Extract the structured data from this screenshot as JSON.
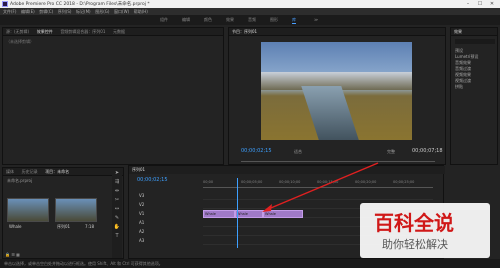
{
  "titlebar": {
    "title": "Adobe Premiere Pro CC 2018 - D:\\Program Files\\未命名.prproj *",
    "min": "–",
    "max": "☐",
    "close": "✕"
  },
  "menu": [
    "文件(F)",
    "编辑(E)",
    "剪辑(C)",
    "序列(S)",
    "标记(M)",
    "图形(G)",
    "窗口(W)",
    "帮助(H)"
  ],
  "workspaces": [
    "组件",
    "编辑",
    "颜色",
    "效果",
    "音频",
    "图形",
    "库",
    "≫"
  ],
  "source_panel": {
    "tabs": [
      "源：(无剪辑)",
      "效果控件",
      "音频剪辑混合器：序列01",
      "元数据"
    ],
    "note": "（未选择剪辑）"
  },
  "program_panel": {
    "tab": "节目：序列01",
    "timecode": "00;00;02;15",
    "fit": "适合",
    "quality": "完整",
    "duration": "00;00;07;18"
  },
  "effects_panel": {
    "tab": "效果",
    "items": [
      "预设",
      "Lumetri预设",
      "音频效果",
      "音频过渡",
      "视频效果",
      "视频过渡",
      "拼贴"
    ]
  },
  "project_panel": {
    "tabs": [
      "媒体",
      "历史记录",
      "项目：未命名"
    ],
    "file": "未命名.prproj",
    "clips": [
      {
        "name": "Whale",
        "duration": ""
      },
      {
        "name": "序列01",
        "duration": "7:18"
      }
    ]
  },
  "timeline": {
    "tab": "序列01",
    "timecode": "00;00;02;15",
    "ruler": [
      "00;00",
      "00;00;05;00",
      "00;00;10;00",
      "00;00;15;00",
      "00;00;20;00",
      "00;00;25;00"
    ],
    "tracks": [
      "V3",
      "V2",
      "V1",
      "A1",
      "A2",
      "A3"
    ],
    "clip_label": "Whale"
  },
  "statusbar": {
    "text": "单击以选择，或单击空白处并拖动以进行框选。使用 Shift、Alt 和 Ctrl 可获得其他选项。"
  },
  "watermark": {
    "title": "百科全说",
    "subtitle": "助你轻松解决"
  },
  "colors": {
    "accent": "#3da0ff",
    "clip": "#a07ac8",
    "arrow": "#e02020"
  }
}
